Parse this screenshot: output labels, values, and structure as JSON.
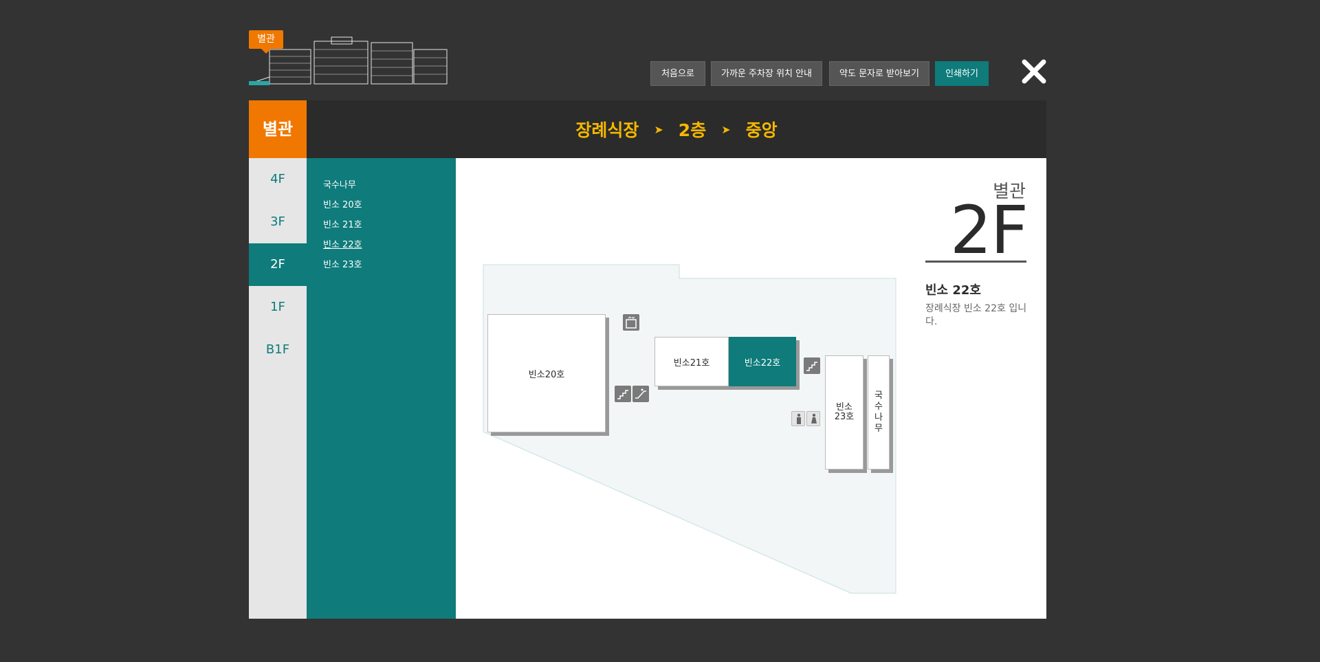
{
  "header": {
    "building_tag": "별관",
    "buttons": {
      "home": "처음으로",
      "parking": "가까운 주차장 위치 안내",
      "sms": "약도 문자로 받아보기",
      "print": "인쇄하기"
    }
  },
  "title_bar": {
    "building": "별관",
    "breadcrumb": [
      "장례식장",
      "2층",
      "중앙"
    ],
    "separator": "➤"
  },
  "floors": [
    "4F",
    "3F",
    "2F",
    "1F",
    "B1F"
  ],
  "active_floor": "2F",
  "rooms_list": [
    "국수나무",
    "빈소 20호",
    "빈소 21호",
    "빈소 22호",
    "빈소 23호"
  ],
  "active_room": "빈소 22호",
  "map": {
    "rooms": {
      "r20": "빈소20호",
      "r21": "빈소21호",
      "r22": "빈소22호",
      "r23": "빈소\n23호",
      "noodle": "국\n수\n나\n무"
    }
  },
  "info": {
    "building": "별관",
    "floor": "2F",
    "title": "빈소 22호",
    "description": "장례식장 빈소 22호 입니다."
  },
  "colors": {
    "accent_orange": "#f07800",
    "accent_teal": "#0f7b7b",
    "breadcrumb_yellow": "#f5b800"
  }
}
